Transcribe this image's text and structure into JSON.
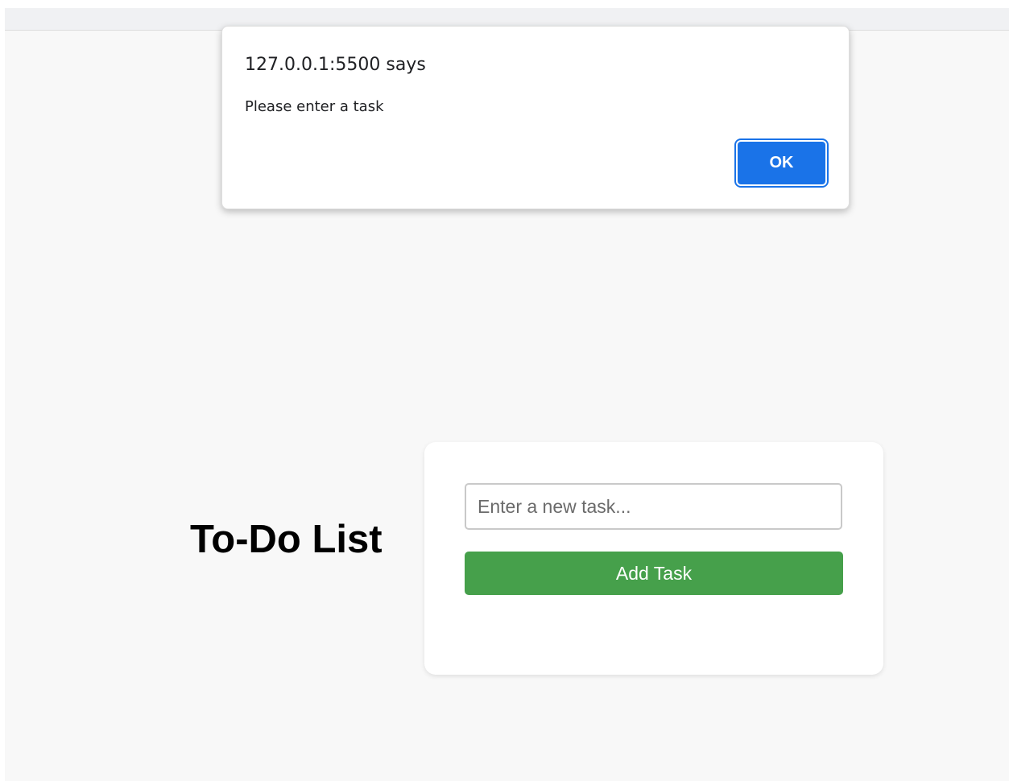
{
  "alert": {
    "origin": "127.0.0.1:5500 says",
    "message": "Please enter a task",
    "ok_label": "OK"
  },
  "todo": {
    "title": "To-Do List",
    "input_placeholder": "Enter a new task...",
    "input_value": "",
    "add_button_label": "Add Task"
  },
  "colors": {
    "accent_blue": "#1a73e8",
    "add_button_green": "#46a04b",
    "page_background": "#f8f8f8"
  }
}
